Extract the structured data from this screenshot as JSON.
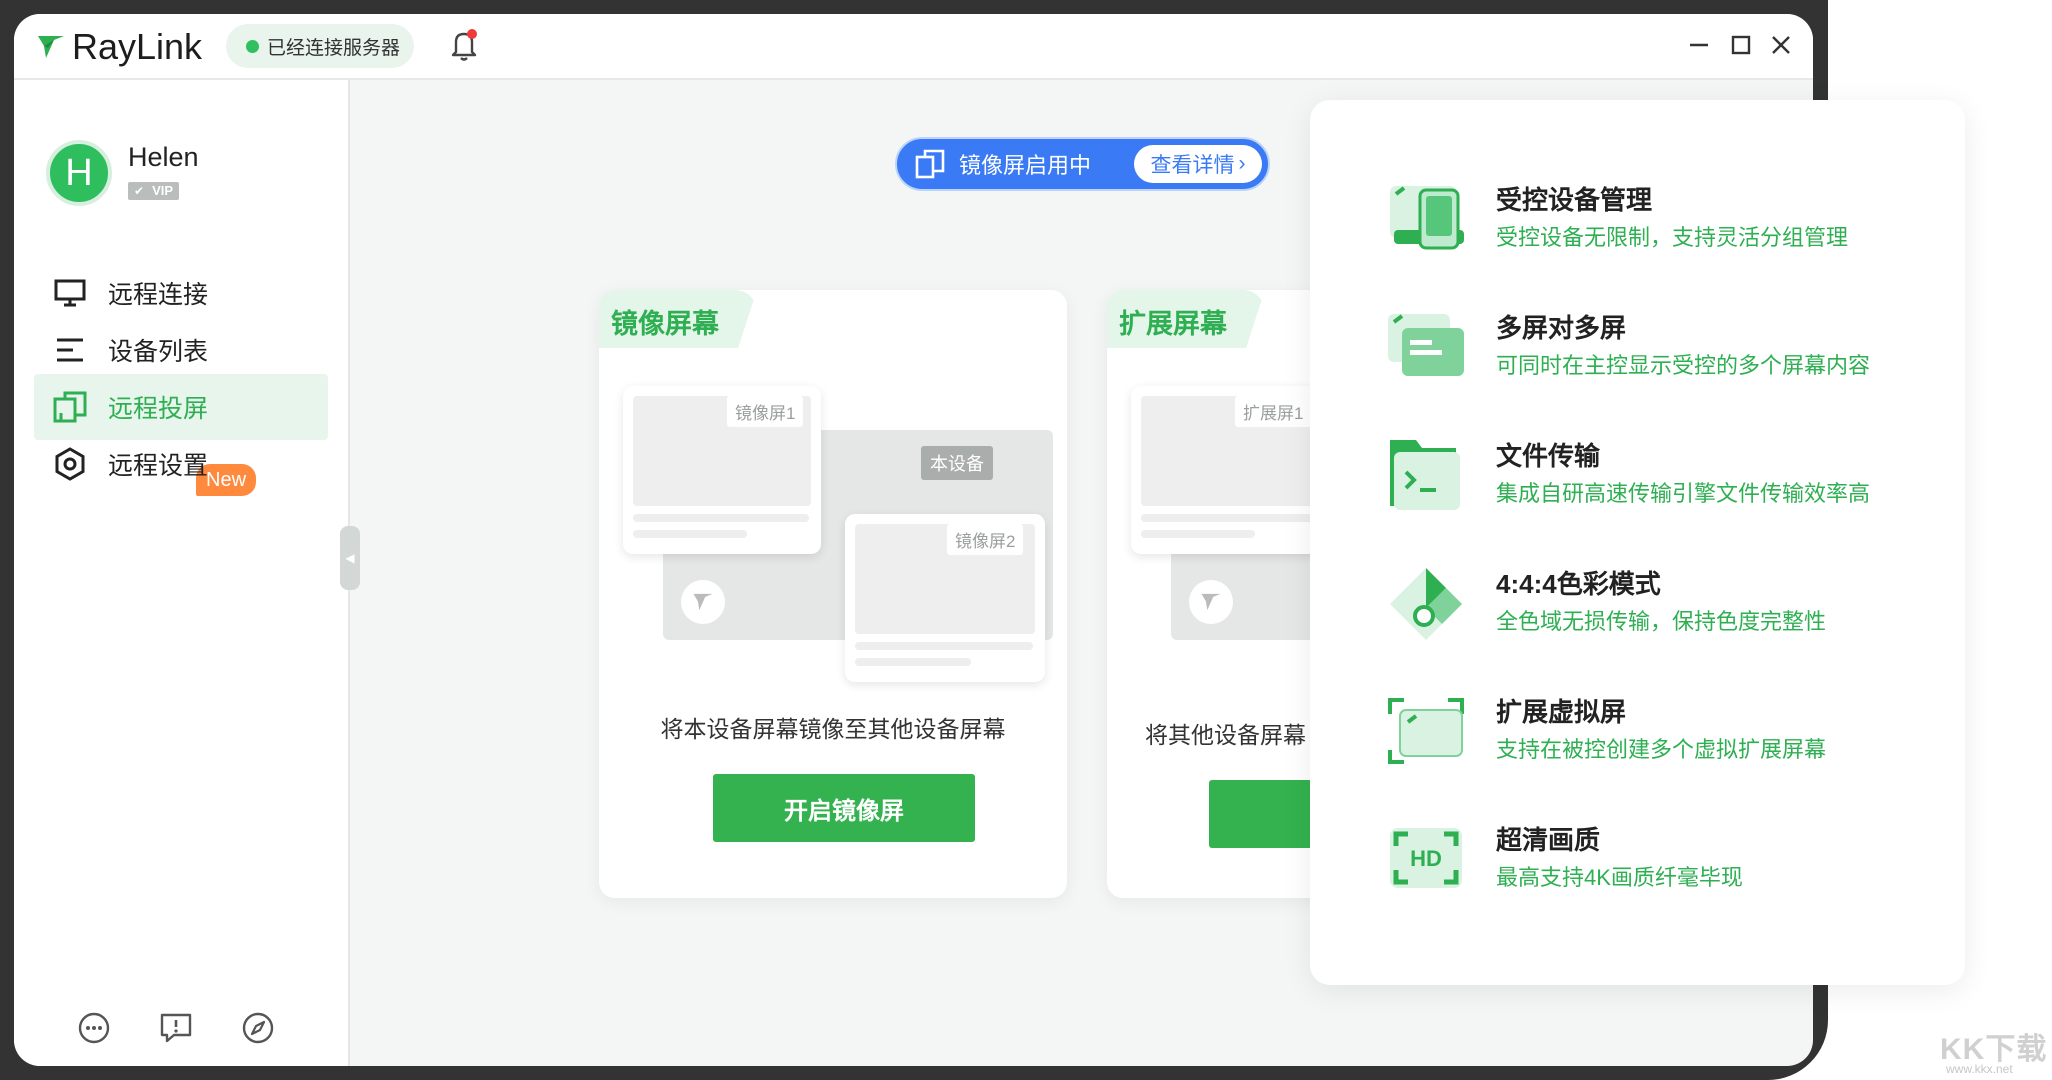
{
  "app": {
    "name": "RayLink",
    "server_status": "已经连接服务器"
  },
  "user": {
    "initial": "H",
    "name": "Helen",
    "vip_label": "VIP"
  },
  "nav": {
    "items": [
      {
        "label": "远程连接",
        "icon": "monitor-icon"
      },
      {
        "label": "设备列表",
        "icon": "list-icon"
      },
      {
        "label": "远程投屏",
        "icon": "screen-cast-icon",
        "active": true
      },
      {
        "label": "远程设置",
        "icon": "settings-hex-icon"
      }
    ],
    "new_badge": "New",
    "footer_icons": [
      "chat-icon",
      "feedback-icon",
      "compass-icon"
    ]
  },
  "mirror_banner": {
    "status": "镜像屏启用中",
    "detail_button": "查看详情"
  },
  "cards": [
    {
      "title": "镜像屏幕",
      "labels": {
        "screen1": "镜像屏1",
        "local": "本设备",
        "screen2": "镜像屏2"
      },
      "description": "将本设备屏幕镜像至其他设备屏幕",
      "button": "开启镜像屏"
    },
    {
      "title": "扩展屏幕",
      "labels": {
        "screen1": "扩展屏1"
      },
      "description": "将其他设备屏幕",
      "button": "开"
    }
  ],
  "features": [
    {
      "title": "受控设备管理",
      "desc": "受控设备无限制，支持灵活分组管理",
      "icon": "device-manage-icon"
    },
    {
      "title": "多屏对多屏",
      "desc": "可同时在主控显示受控的多个屏幕内容",
      "icon": "multi-screen-icon"
    },
    {
      "title": "文件传输",
      "desc": "集成自研高速传输引擎文件传输效率高",
      "icon": "file-transfer-icon"
    },
    {
      "title": "4:4:4色彩模式",
      "desc": "全色域无损传输，保持色度完整性",
      "icon": "color-mode-icon"
    },
    {
      "title": "扩展虚拟屏",
      "desc": "支持在被控创建多个虚拟扩展屏幕",
      "icon": "virtual-screen-icon"
    },
    {
      "title": "超清画质",
      "desc": "最高支持4K画质纤毫毕现",
      "icon": "hd-icon"
    }
  ],
  "colors": {
    "accent": "#2eaf52",
    "blue": "#3a7bf5",
    "badge_orange": "#ff8a3d"
  },
  "watermark": {
    "text": "KK下载",
    "url_text": "www.kkx.net"
  }
}
